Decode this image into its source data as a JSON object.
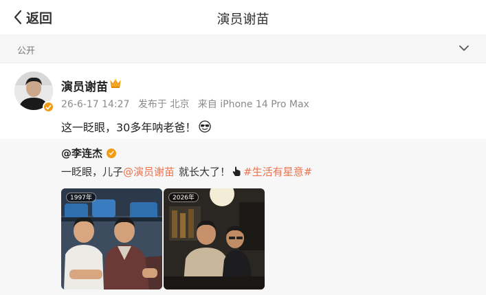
{
  "navbar": {
    "back_label": "返回",
    "title": "演员谢苗"
  },
  "visibility": {
    "label": "公开"
  },
  "post": {
    "author": "演员谢苗",
    "date": "26-6-17 14:27",
    "location": "发布于 北京",
    "device": "来自 iPhone 14 Pro Max",
    "text": "这一眨眼，30多年呐老爸！",
    "repost": {
      "author": "@李连杰",
      "text_before": "一眨眼，儿子",
      "mention": "@演员谢苗",
      "text_after": "就长大了！",
      "hashtag": "#生活有星意#",
      "photos": [
        {
          "year_tag": "1997年"
        },
        {
          "year_tag": "2026年"
        }
      ]
    }
  },
  "colors": {
    "accent": "#eb7350",
    "badge": "#f29c16"
  }
}
